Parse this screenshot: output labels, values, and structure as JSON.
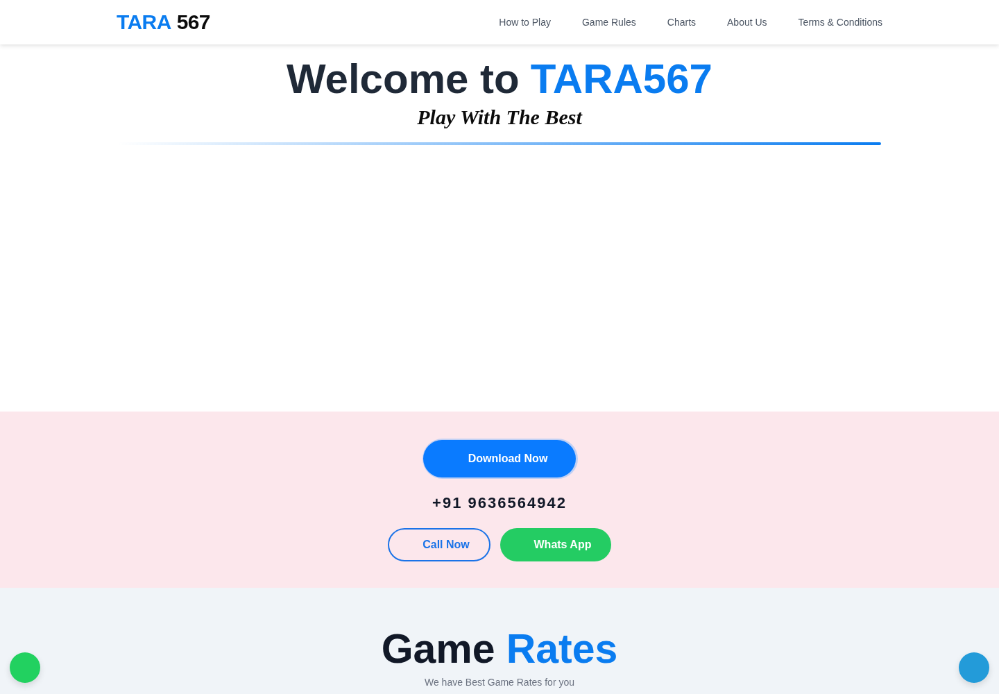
{
  "header": {
    "logo": {
      "brand": "TARA",
      "number": "567"
    },
    "nav": [
      "How to Play",
      "Game Rules",
      "Charts",
      "About Us",
      "Terms & Conditions"
    ]
  },
  "hero": {
    "title": "Welcome to",
    "title_highlight": "TARA567",
    "tagline": "Play With The Best"
  },
  "contact": {
    "download_button": "Download Now",
    "phone": "+91 9636564942",
    "buttons": [
      {
        "kind": "outline",
        "label": "Call Now"
      },
      {
        "kind": "whatsapp",
        "label": "Whats App"
      }
    ]
  },
  "rates": {
    "title": "Game",
    "title_highlight": "Rates",
    "subtitle": "We have Best Game Rates for you"
  }
}
